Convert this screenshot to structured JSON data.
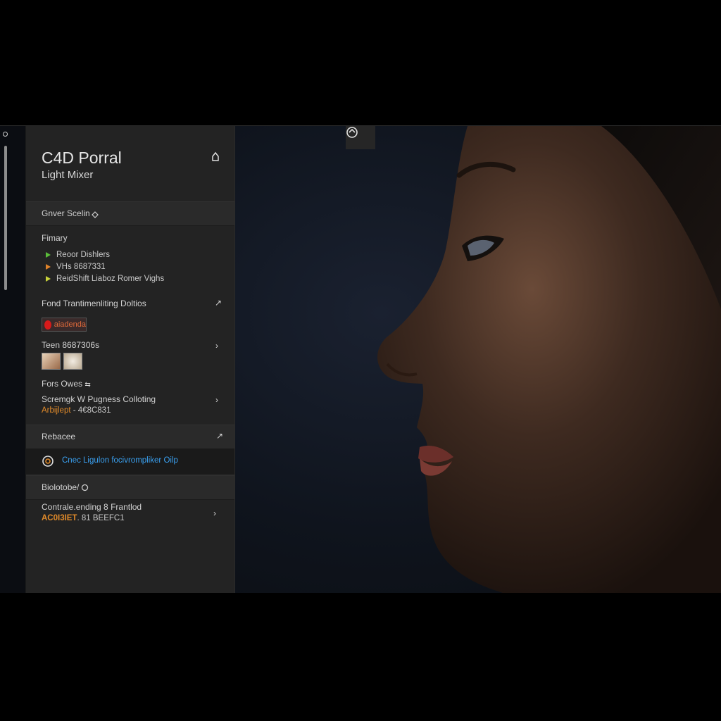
{
  "panel": {
    "title": "C4D Porral",
    "subtitle": "Light Mixer",
    "cover_section": {
      "label": "Gnver Scelin"
    },
    "primary": {
      "heading": "Fimary",
      "items": [
        {
          "label": "Reoor Dishlers",
          "color": "#5bbd3a"
        },
        {
          "label": "VHs 8687331",
          "color": "#e0832a"
        },
        {
          "label": "ReidShift Liaboz Romer Vighs",
          "color": "#c8d23a"
        }
      ]
    },
    "fond": {
      "heading": "Fond Trantimenliting Doltios"
    },
    "swatch": {
      "label": "aiadenda",
      "color": "#d81a1a"
    },
    "team": {
      "label": "Teen 8687306s"
    },
    "fors": {
      "label": "Fors Owes"
    },
    "screngk": {
      "label": "Scremgk W Pugness Colloting",
      "value_prefix": "Arbijlept",
      "value_suffix": "- 4€8C831"
    },
    "reference": {
      "label": "Rebacee"
    },
    "link": {
      "label": "Cnec Ligulon focivrompliker Oilp",
      "color": "#3aa0f0"
    },
    "biolobe": {
      "label": "Biolotobe/"
    },
    "contrale": {
      "label": "Contrale.ending 8 Frantlod",
      "value_orange": "AC0I3IET",
      "value_rest": ". 81 BEEFC1"
    }
  },
  "colors": {
    "panel_bg": "#232323",
    "accent_orange": "#e08a2a",
    "accent_blue": "#3aa0f0"
  }
}
